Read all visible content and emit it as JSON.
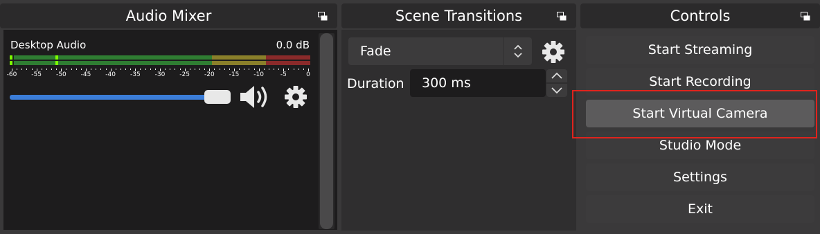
{
  "audio_mixer": {
    "title": "Audio Mixer",
    "source_name": "Desktop Audio",
    "level": "0.0 dB",
    "scale_labels": [
      "-60",
      "-55",
      "-50",
      "-45",
      "-40",
      "-35",
      "-30",
      "-25",
      "-20",
      "-15",
      "-10",
      "-5",
      "0"
    ],
    "volume_fraction": 1.0,
    "colors": {
      "green": "#2f7d32",
      "yellow": "#8a7f2a",
      "red": "#8a2a2a",
      "peak": "#7cfc00",
      "slider": "#3b7dd8"
    }
  },
  "scene_transitions": {
    "title": "Scene Transitions",
    "transition": "Fade",
    "duration_label": "Duration",
    "duration_value": "300 ms"
  },
  "controls": {
    "title": "Controls",
    "buttons": [
      "Start Streaming",
      "Start Recording",
      "Start Virtual Camera",
      "Studio Mode",
      "Settings",
      "Exit"
    ],
    "highlighted_button": "Start Virtual Camera",
    "highlight_color": "#e1231d"
  }
}
